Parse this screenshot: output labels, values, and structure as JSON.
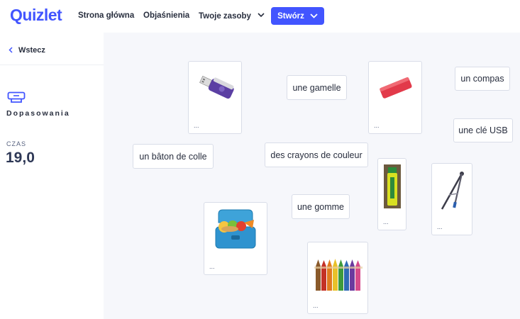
{
  "header": {
    "logo": "Quizlet",
    "nav": {
      "home": "Strona główna",
      "explanations": "Objaśnienia",
      "resources": "Twoje zasoby",
      "create": "Stwórz"
    }
  },
  "sidebar": {
    "back": "Wstecz",
    "mode": "Dopasowania",
    "time_label": "CZAS",
    "time_value": "19,0"
  },
  "board": {
    "words": {
      "w1": "une gamelle",
      "w2": "un compas",
      "w3": "une clé USB",
      "w4": "un bâton de colle",
      "w5": "des crayons de couleur",
      "w6": "une gomme"
    },
    "image_placeholder": "...",
    "images": {
      "usb": "usb-stick",
      "eraser": "eraser",
      "glue": "glue-stick",
      "compass": "compass",
      "lunchbox": "lunchbox",
      "pencils": "colored-pencils"
    }
  },
  "colors": {
    "brand": "#4255ff",
    "board_bg": "#f6f7fb",
    "text": "#282e3e"
  }
}
